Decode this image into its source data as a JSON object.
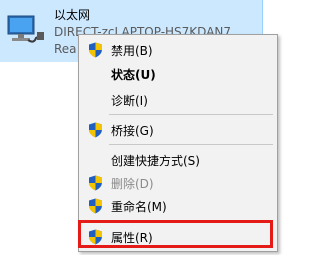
{
  "adapter": {
    "name": "以太网",
    "device": "DIRECT-zcLAPTOP-HS7KDAN7...",
    "status_partial": "Rea",
    "icon": "network-adapter-icon"
  },
  "menu": {
    "items": [
      {
        "label": "禁用(B)",
        "shield": true,
        "bold": false,
        "disabled": false
      },
      {
        "label": "状态(U)",
        "shield": false,
        "bold": true,
        "disabled": false
      },
      {
        "label": "诊断(I)",
        "shield": false,
        "bold": false,
        "disabled": false
      },
      {
        "label": "桥接(G)",
        "shield": true,
        "bold": false,
        "disabled": false
      },
      {
        "label": "创建快捷方式(S)",
        "shield": false,
        "bold": false,
        "disabled": false
      },
      {
        "label": "删除(D)",
        "shield": true,
        "bold": false,
        "disabled": true
      },
      {
        "label": "重命名(M)",
        "shield": true,
        "bold": false,
        "disabled": false
      },
      {
        "label": "属性(R)",
        "shield": true,
        "bold": false,
        "disabled": false
      }
    ]
  },
  "colors": {
    "selection": "#cce8ff",
    "highlight_border": "#e41b17",
    "shield_blue": "#1f5fbf",
    "shield_yellow": "#f5c400"
  }
}
